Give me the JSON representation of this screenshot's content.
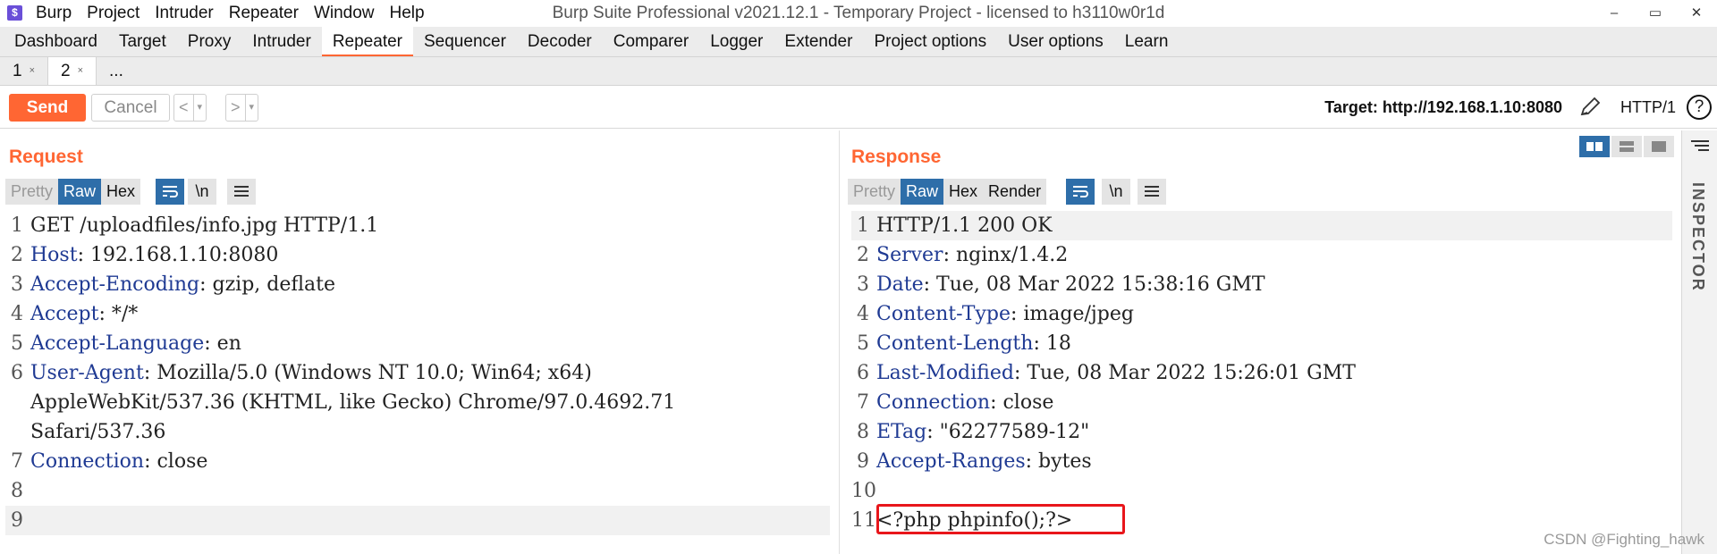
{
  "app": {
    "title": "Burp Suite Professional v2021.12.1 - Temporary Project - licensed to h3110w0r1d",
    "logo_text": "$",
    "menu": [
      "Burp",
      "Project",
      "Intruder",
      "Repeater",
      "Window",
      "Help"
    ],
    "window_controls": [
      "–",
      "▭",
      "✕"
    ]
  },
  "main_tabs": [
    "Dashboard",
    "Target",
    "Proxy",
    "Intruder",
    "Repeater",
    "Sequencer",
    "Decoder",
    "Comparer",
    "Logger",
    "Extender",
    "Project options",
    "User options",
    "Learn"
  ],
  "main_tab_active": "Repeater",
  "sub_tabs": [
    {
      "label": "1",
      "close": "×"
    },
    {
      "label": "2",
      "close": "×"
    },
    {
      "label": "..."
    }
  ],
  "toolbar": {
    "send": "Send",
    "cancel": "Cancel",
    "back": "<",
    "forward": ">",
    "dropdown": "▾",
    "target": "Target: http://192.168.1.10:8080",
    "http_version": "HTTP/1",
    "help": "?"
  },
  "request": {
    "title": "Request",
    "view_tabs": [
      "Pretty",
      "Raw",
      "Hex"
    ],
    "active_view": "Raw",
    "icons": [
      "wrap-icon",
      "newline-icon",
      "menu-icon"
    ],
    "newline_label": "\\n",
    "lines": [
      {
        "n": "1",
        "k": "",
        "v": "GET /uploadfiles/info.jpg HTTP/1.1"
      },
      {
        "n": "2",
        "k": "Host",
        "v": ": 192.168.1.10:8080"
      },
      {
        "n": "3",
        "k": "Accept-Encoding",
        "v": ": gzip, deflate"
      },
      {
        "n": "4",
        "k": "Accept",
        "v": ": */*"
      },
      {
        "n": "5",
        "k": "Accept-Language",
        "v": ": en"
      },
      {
        "n": "6",
        "k": "User-Agent",
        "v": ": Mozilla/5.0 (Windows NT 10.0; Win64; x64)"
      },
      {
        "n": "",
        "k": "",
        "v": "AppleWebKit/537.36 (KHTML, like Gecko) Chrome/97.0.4692.71"
      },
      {
        "n": "",
        "k": "",
        "v": "Safari/537.36"
      },
      {
        "n": "7",
        "k": "Connection",
        "v": ": close"
      },
      {
        "n": "8",
        "k": "",
        "v": ""
      },
      {
        "n": "9",
        "k": "",
        "v": ""
      }
    ]
  },
  "response": {
    "title": "Response",
    "view_tabs": [
      "Pretty",
      "Raw",
      "Hex",
      "Render"
    ],
    "active_view": "Raw",
    "newline_label": "\\n",
    "lines": [
      {
        "n": "1",
        "k": "",
        "v": "HTTP/1.1 200 OK"
      },
      {
        "n": "2",
        "k": "Server",
        "v": ": nginx/1.4.2"
      },
      {
        "n": "3",
        "k": "Date",
        "v": ": Tue, 08 Mar 2022 15:38:16 GMT"
      },
      {
        "n": "4",
        "k": "Content-Type",
        "v": ": image/jpeg"
      },
      {
        "n": "5",
        "k": "Content-Length",
        "v": ": 18"
      },
      {
        "n": "6",
        "k": "Last-Modified",
        "v": ": Tue, 08 Mar 2022 15:26:01 GMT"
      },
      {
        "n": "7",
        "k": "Connection",
        "v": ": close"
      },
      {
        "n": "8",
        "k": "ETag",
        "v": ": \"62277589-12\""
      },
      {
        "n": "9",
        "k": "Accept-Ranges",
        "v": ": bytes"
      },
      {
        "n": "10",
        "k": "",
        "v": ""
      },
      {
        "n": "11",
        "k": "",
        "v": "<?php phpinfo();?>"
      }
    ]
  },
  "inspector": {
    "label": "INSPECTOR"
  },
  "watermark": "CSDN @Fighting_hawk",
  "colors": {
    "accent": "#ff6633",
    "active_blue": "#2e6ea9",
    "header_key": "#1f3a93",
    "highlight_box": "#e8161b"
  }
}
